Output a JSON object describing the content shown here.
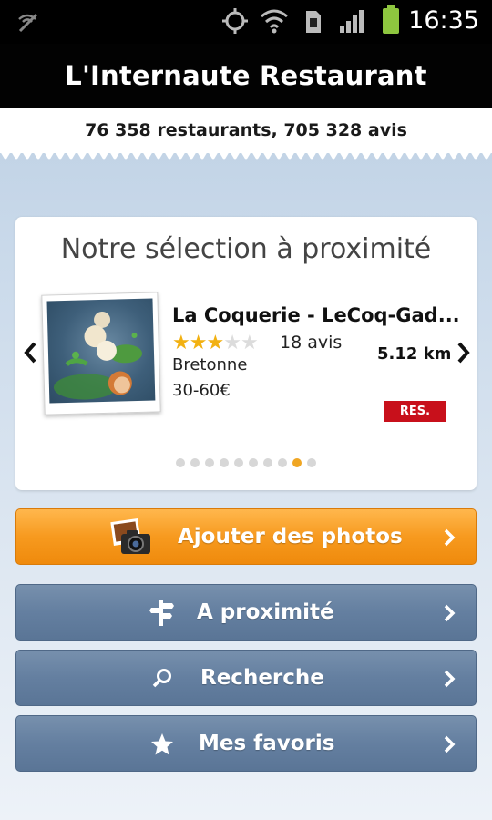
{
  "status_bar": {
    "time": "16:35",
    "icons": [
      "nfc-icon",
      "gps-icon",
      "wifi-icon",
      "sim-icon",
      "signal-icon",
      "battery-icon"
    ]
  },
  "header": {
    "title": "L'Internaute Restaurant"
  },
  "stats": {
    "text": "76 358 restaurants, 705 328 avis"
  },
  "selection": {
    "title": "Notre sélection à proximité",
    "restaurant": {
      "name": "La Coquerie - LeCoq-Gad...",
      "rating": 3,
      "rating_max": 5,
      "reviews": "18 avis",
      "cuisine": "Bretonne",
      "price": "30-60€",
      "distance": "5.12 km",
      "badge": "RES."
    },
    "pagination": {
      "total": 10,
      "active": 9
    }
  },
  "buttons": {
    "add_photos": "Ajouter des photos",
    "nearby": "A proximité",
    "search": "Recherche",
    "favorites": "Mes favoris"
  },
  "colors": {
    "accent_orange": "#f79a1f",
    "button_blue": "#647fa0",
    "star": "#f2b112",
    "badge_red": "#c8101b"
  }
}
